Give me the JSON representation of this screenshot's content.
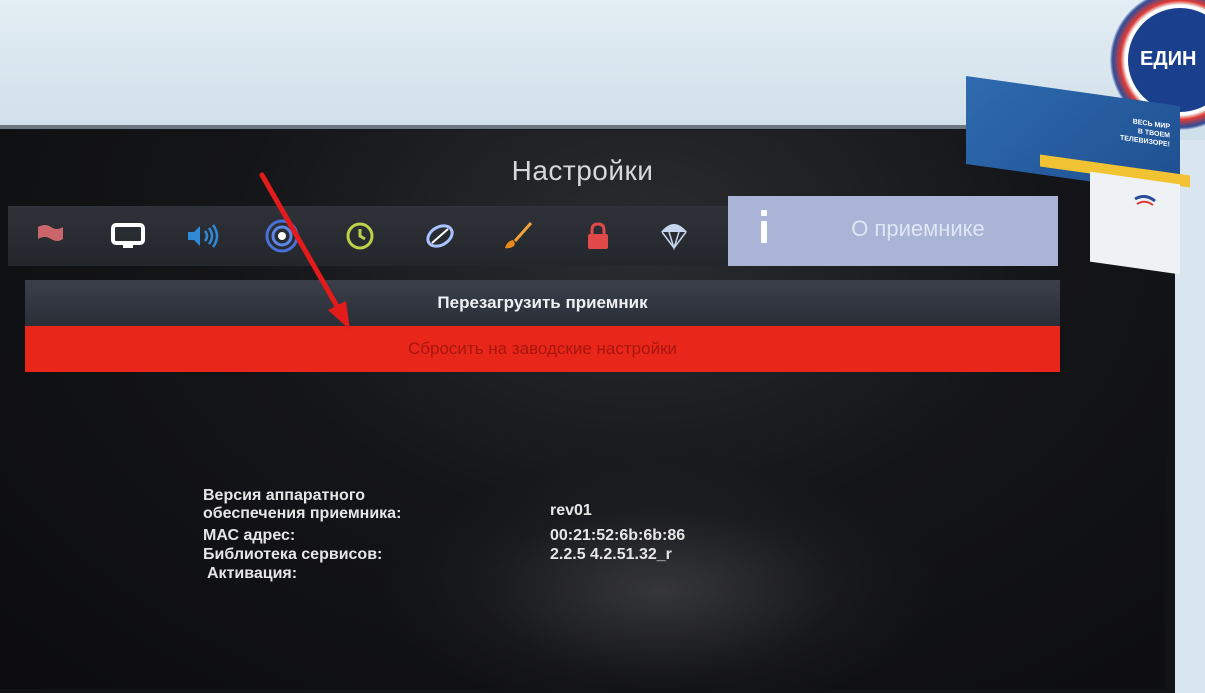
{
  "settings": {
    "title": "Настройки",
    "active_tab_label": "О приемнике",
    "toolbar_icons": [
      {
        "name": "language-flag-icon",
        "glyph": "⚑",
        "color": "#c9656b"
      },
      {
        "name": "tv-display-icon",
        "glyph": "▭",
        "color": "#ffffff"
      },
      {
        "name": "sound-icon",
        "glyph": "◂)))",
        "color": "#2f8ad8"
      },
      {
        "name": "network-icon",
        "glyph": "◉",
        "color": "#3b63c9"
      },
      {
        "name": "clock-icon",
        "glyph": "◷",
        "color": "#bcd04a"
      },
      {
        "name": "satellite-icon",
        "glyph": "⊘",
        "color": "#7aa7ff"
      },
      {
        "name": "brush-icon",
        "glyph": "⟋",
        "color": "#e89a2a"
      },
      {
        "name": "lock-icon",
        "glyph": "🔒︎",
        "color": "#e24a4a"
      },
      {
        "name": "parachute-icon",
        "glyph": "☂",
        "color": "#c7d6ee"
      }
    ],
    "menu": {
      "reboot_label": "Перезагрузить приемник",
      "reset_label": "Сбросить на заводские настройки"
    },
    "info": {
      "hw_version_label_line1": "Версия аппаратного",
      "hw_version_label_line2": "обеспечения приемника:",
      "hw_version_value": "rev01",
      "mac_label": "МАС адрес:",
      "mac_value": "00:21:52:6b:6b:86",
      "services_label": "Библиотека сервисов:",
      "services_value": "2.2.5 4.2.51.32_r",
      "activation_label": "Активация:"
    }
  },
  "branding": {
    "logo_text": "ЕДИН",
    "badge_line1": "ВЕСЬ МИР",
    "badge_line2": "В ТВОЕМ",
    "badge_line3": "ТЕЛЕВИЗОРЕ!"
  },
  "colors": {
    "reset_highlight": "#e8261a",
    "active_tab": "#a9b4d6",
    "annotation_arrow": "#e31b1b"
  }
}
